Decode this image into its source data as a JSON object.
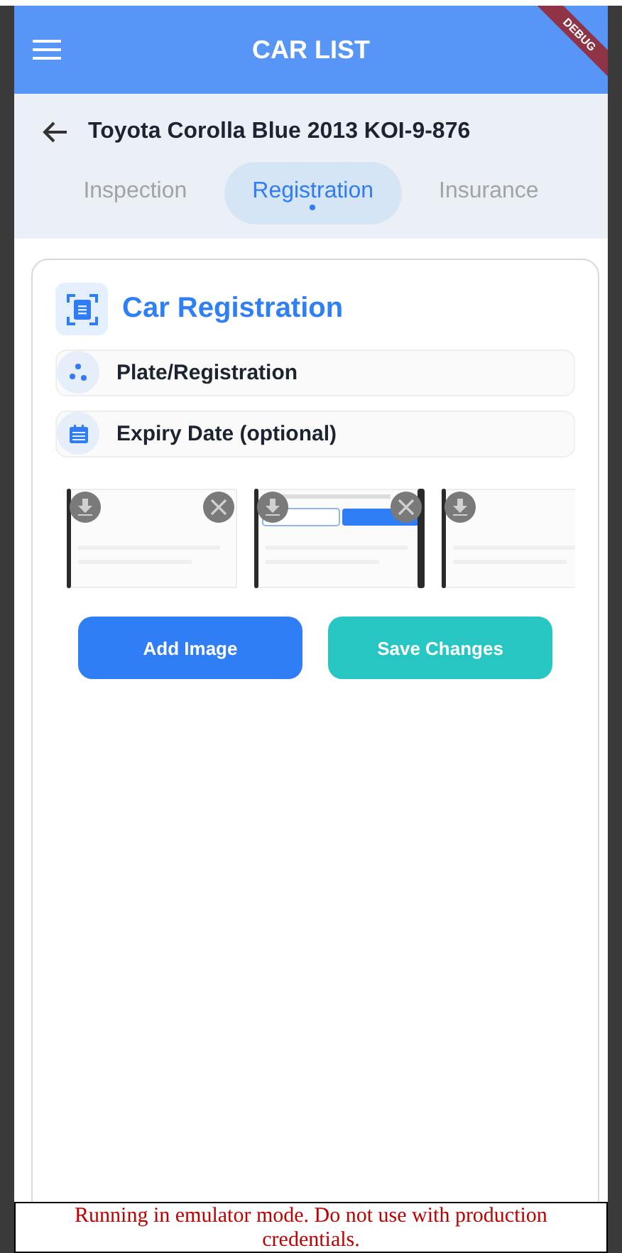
{
  "app_bar": {
    "title": "CAR LIST",
    "debug_banner": "DEBUG"
  },
  "header": {
    "title": "Toyota Corolla Blue 2013 KOI-9-876"
  },
  "tabs": [
    {
      "label": "Inspection",
      "selected": false
    },
    {
      "label": "Registration",
      "selected": true
    },
    {
      "label": "Insurance",
      "selected": false
    }
  ],
  "card": {
    "title": "Car Registration",
    "fields": [
      {
        "kind": "plate",
        "placeholder": "Plate/Registration"
      },
      {
        "kind": "date",
        "placeholder": "Expiry Date (optional)"
      }
    ],
    "images": [
      {
        "kind": "picture",
        "removable": true
      },
      {
        "kind": "picture",
        "removable": true
      },
      {
        "kind": "picture"
      }
    ],
    "buttons": [
      {
        "kind": "add",
        "label": "Add Image"
      },
      {
        "kind": "save",
        "label": "Save Changes"
      }
    ]
  },
  "emulator_notice": "Running in emulator mode. Do not use with production credentials."
}
